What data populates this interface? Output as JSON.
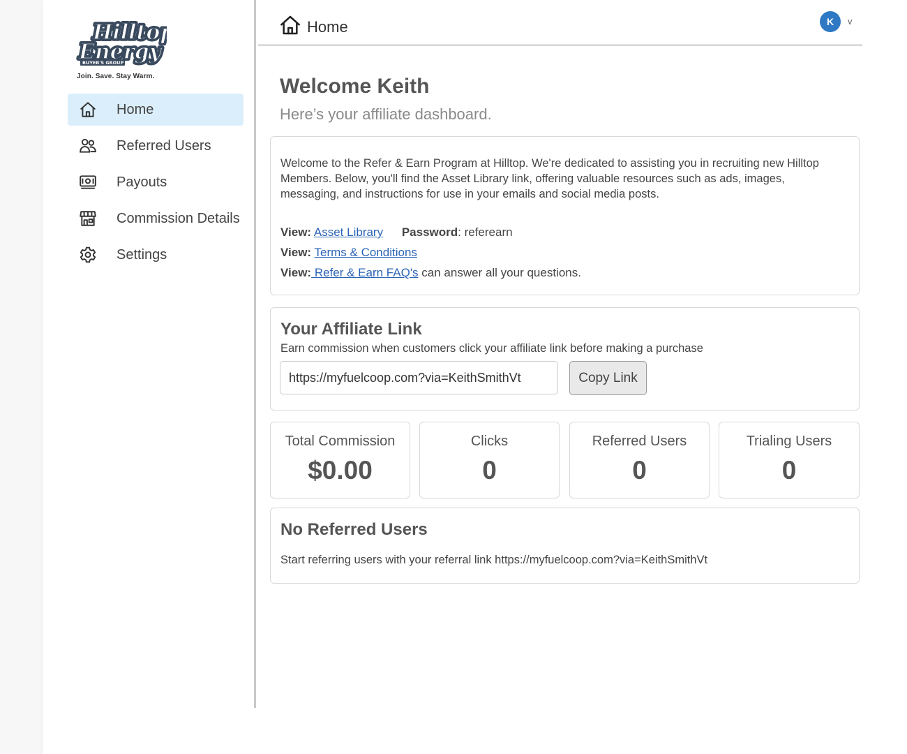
{
  "brand": {
    "logo_line1": "Hilltop",
    "logo_line2": "Energy",
    "logo_badge": "BUYER'S GROUP",
    "tagline": "Join. Save. Stay Warm."
  },
  "sidebar": {
    "items": [
      {
        "label": "Home",
        "icon": "home-icon",
        "active": true
      },
      {
        "label": "Referred Users",
        "icon": "users-icon",
        "active": false
      },
      {
        "label": "Payouts",
        "icon": "money-icon",
        "active": false
      },
      {
        "label": "Commission Details",
        "icon": "storefront-icon",
        "active": false
      },
      {
        "label": "Settings",
        "icon": "gear-icon",
        "active": false
      }
    ]
  },
  "header": {
    "title": "Home",
    "avatar_initial": "K",
    "avatar_caret": "v"
  },
  "main": {
    "welcome": "Welcome Keith",
    "subtitle": "Here’s your affiliate dashboard.",
    "info": {
      "text": "Welcome to the Refer & Earn Program at Hilltop. We're dedicated to assisting you in recruiting new Hilltop Members. Below, you'll find the Asset Library link, offering valuable resources such as ads, images, messaging, and instructions for use in your emails and social media posts.",
      "view_label": "View:",
      "asset_library": "Asset Library",
      "password_label": "Password",
      "password_value": ": referearn",
      "terms": "Terms & Conditions",
      "faq": " Refer & Earn FAQ's",
      "faq_suffix": " can answer all your questions."
    },
    "affiliate": {
      "title": "Your Affiliate Link",
      "description": "Earn commission when customers click your affiliate link before making a purchase",
      "link_value": "https://myfuelcoop.com?via=KeithSmithVt",
      "copy_label": "Copy Link"
    },
    "stats": [
      {
        "label": "Total Commission",
        "value": "$0.00"
      },
      {
        "label": "Clicks",
        "value": "0"
      },
      {
        "label": "Referred Users",
        "value": "0"
      },
      {
        "label": "Trialing Users",
        "value": "0"
      }
    ],
    "referred": {
      "title": "No Referred Users",
      "text": "Start referring users with your referral link https://myfuelcoop.com?via=KeithSmithVt"
    }
  },
  "colors": {
    "accent": "#2f78c4",
    "active_nav_bg": "#dbeefb",
    "link": "#2b64b5",
    "logo": "#3a4a5e"
  }
}
